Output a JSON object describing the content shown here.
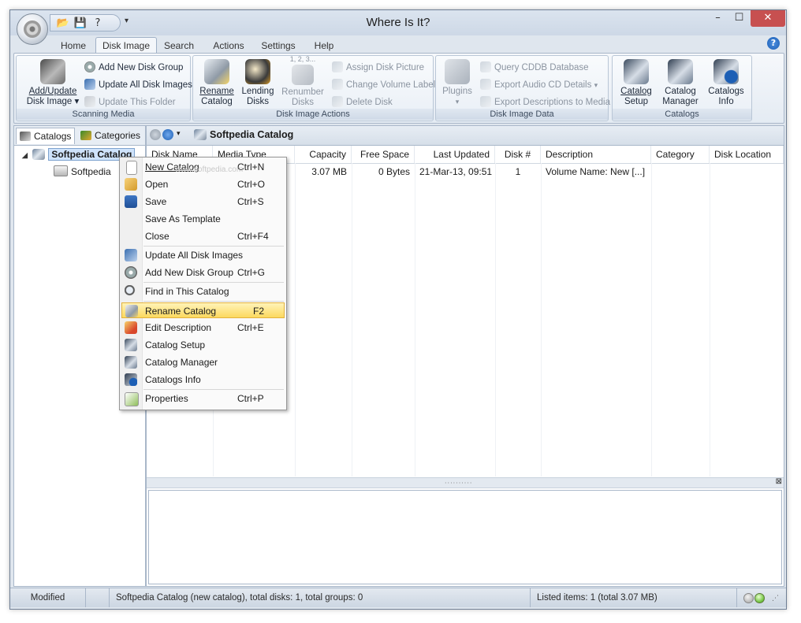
{
  "window": {
    "title": "Where Is It?",
    "minimize_glyph": "–",
    "maximize_glyph": "☐",
    "close_glyph": "✕"
  },
  "ribbon_tabs": [
    "Home",
    "Disk Image",
    "Search",
    "Actions",
    "Settings",
    "Help"
  ],
  "active_tab": "Disk Image",
  "ribbon": {
    "scanning_media": {
      "label": "Scanning Media",
      "add_update_line1": "Add/Update",
      "add_update_line2": "Disk Image",
      "add_new_disk_group": "Add New Disk Group",
      "update_all_disk_images": "Update All Disk Images",
      "update_this_folder": "Update This Folder"
    },
    "disk_image_actions": {
      "label": "Disk Image Actions",
      "rename_line1": "Rename",
      "rename_line2": "Catalog",
      "lending_line1": "Lending",
      "lending_line2": "Disks",
      "renumber_top": "1, 2, 3...",
      "renumber_line1": "Renumber",
      "renumber_line2": "Disks",
      "assign_disk_picture": "Assign Disk Picture",
      "change_volume_label": "Change Volume Label",
      "delete_disk": "Delete Disk"
    },
    "disk_image_data": {
      "label": "Disk Image Data",
      "plugins": "Plugins",
      "query_cddb": "Query CDDB Database",
      "export_audio_cd": "Export Audio CD Details",
      "export_descriptions": "Export Descriptions to Media"
    },
    "catalogs": {
      "label": "Catalogs",
      "setup_line1": "Catalog",
      "setup_line2": "Setup",
      "manager_line1": "Catalog",
      "manager_line2": "Manager",
      "info_line1": "Catalogs",
      "info_line2": "Info"
    }
  },
  "left_pane": {
    "tabs": [
      "Catalogs",
      "Categories"
    ],
    "tree": {
      "root": "Softpedia Catalog",
      "children": [
        "Softpedia"
      ]
    }
  },
  "right_pane": {
    "title": "Softpedia Catalog",
    "columns": [
      "Disk Name",
      "Media Type",
      "Capacity",
      "Free Space",
      "Last Updated",
      "Disk #",
      "Description",
      "Category",
      "Disk Location"
    ],
    "rows": [
      [
        "",
        "",
        "3.07 MB",
        "0 Bytes",
        "21-Mar-13, 09:51",
        "1",
        "Volume Name: New [...]",
        "",
        ""
      ]
    ]
  },
  "context_menu": {
    "items": [
      {
        "label": "New Catalog",
        "shortcut": "Ctrl+N",
        "icon": "new-document-icon"
      },
      {
        "label": "Open",
        "shortcut": "Ctrl+O",
        "icon": "open-folder-icon"
      },
      {
        "label": "Save",
        "shortcut": "Ctrl+S",
        "icon": "save-disk-icon"
      },
      {
        "label": "Save As Template",
        "shortcut": "",
        "icon": ""
      },
      {
        "label": "Close",
        "shortcut": "Ctrl+F4",
        "icon": ""
      },
      {
        "label": "Update All Disk Images",
        "shortcut": "",
        "icon": "update-disks-icon"
      },
      {
        "label": "Add New Disk Group",
        "shortcut": "Ctrl+G",
        "icon": "disk-group-icon"
      },
      {
        "label": "Find in This Catalog",
        "shortcut": "",
        "icon": "find-icon"
      },
      {
        "label": "Rename Catalog",
        "shortcut": "F2",
        "icon": "rename-icon"
      },
      {
        "label": "Edit Description",
        "shortcut": "Ctrl+E",
        "icon": "edit-icon"
      },
      {
        "label": "Catalog Setup",
        "shortcut": "",
        "icon": "catalog-setup-icon"
      },
      {
        "label": "Catalog Manager",
        "shortcut": "",
        "icon": "catalog-manager-icon"
      },
      {
        "label": "Catalogs Info",
        "shortcut": "",
        "icon": "info-icon"
      },
      {
        "label": "Properties",
        "shortcut": "Ctrl+P",
        "icon": "properties-icon"
      }
    ],
    "highlighted": "Rename Catalog"
  },
  "statusbar": {
    "mode": "Modified",
    "summary": "Softpedia Catalog (new catalog), total disks: 1, total groups: 0",
    "listed": "Listed items: 1 (total 3.07 MB)"
  },
  "watermark": "www.softpedia.com",
  "colors": {
    "accent": "#1d5fb5",
    "highlight": "#fcd95f",
    "close_button": "#c75050"
  }
}
